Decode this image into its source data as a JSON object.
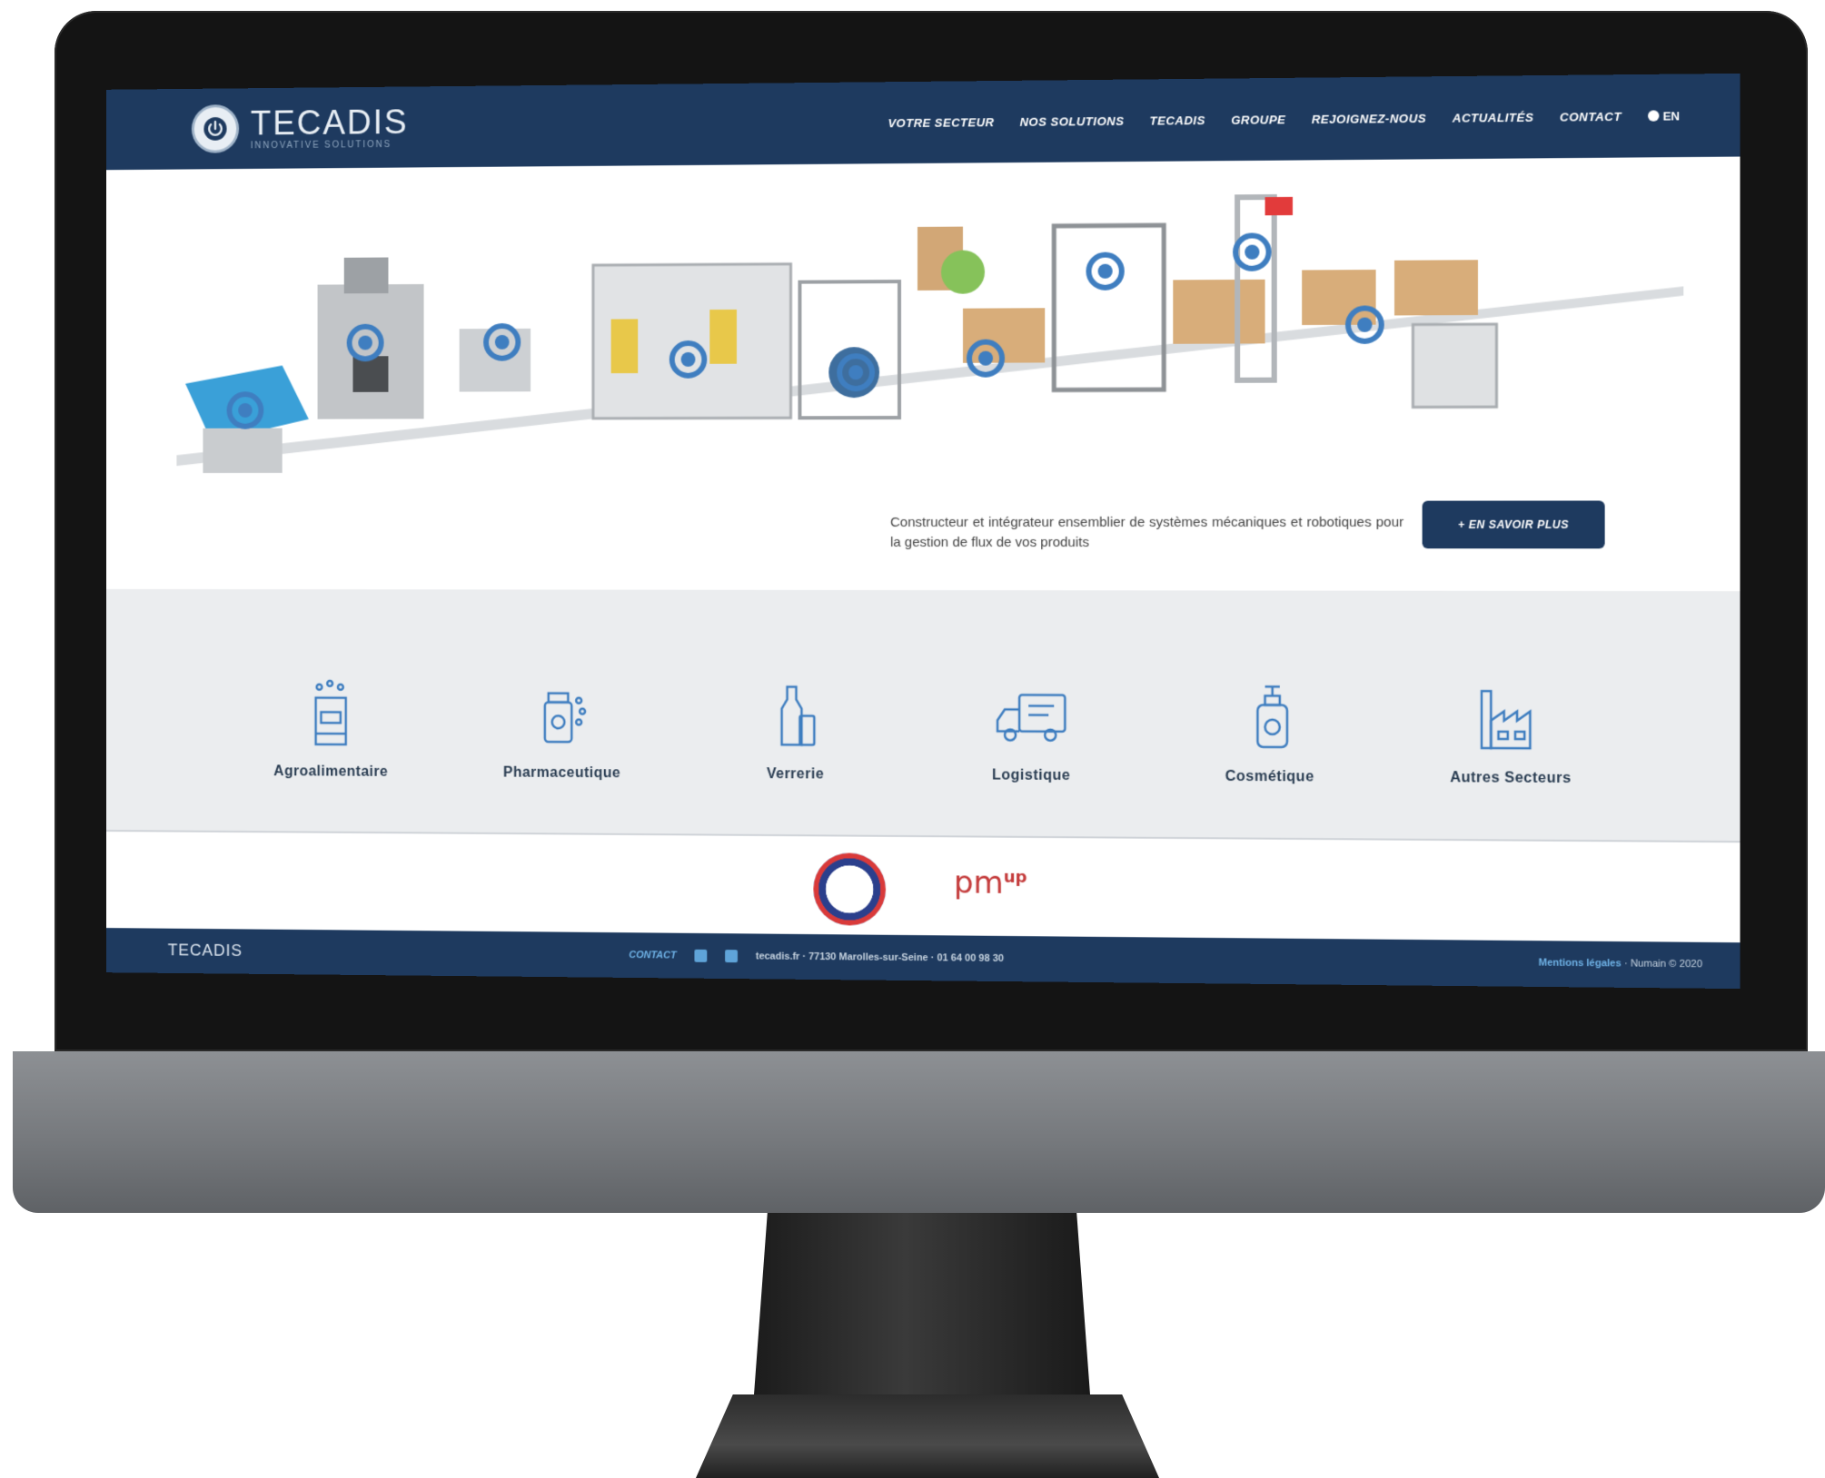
{
  "header": {
    "logo_name": "TECADIS",
    "logo_tagline": "INNOVATIVE SOLUTIONS",
    "nav": [
      "VOTRE SECTEUR",
      "NOS SOLUTIONS",
      "TECADIS",
      "GROUPE",
      "REJOIGNEZ-NOUS",
      "ACTUALITÉS",
      "CONTACT"
    ],
    "lang": "EN"
  },
  "hero": {
    "description": "Constructeur et intégrateur ensemblier de systèmes mécaniques et robotiques pour la gestion de flux de vos produits",
    "cta_label": "+ EN SAVOIR PLUS"
  },
  "sectors": [
    {
      "label": "Agroalimentaire",
      "icon": "food-machine-icon"
    },
    {
      "label": "Pharmaceutique",
      "icon": "pill-bottle-icon"
    },
    {
      "label": "Verrerie",
      "icon": "bottle-jar-icon"
    },
    {
      "label": "Logistique",
      "icon": "truck-icon"
    },
    {
      "label": "Cosmétique",
      "icon": "pump-bottle-icon"
    },
    {
      "label": "Autres Secteurs",
      "icon": "factory-icon"
    }
  ],
  "partners": {
    "pm_text": "pm",
    "pm_up": "up"
  },
  "footer": {
    "brand": "TECADIS",
    "contact_label": "CONTACT",
    "address": "tecadis.fr · 77130 Marolles-sur-Seine · 01 64 00 98 30",
    "legal": "Mentions légales",
    "credit": "Numain © 2020"
  },
  "colors": {
    "header_bg": "#1e3a5f",
    "sector_bg": "#ebedef",
    "accent_blue": "#3f7ec0"
  }
}
